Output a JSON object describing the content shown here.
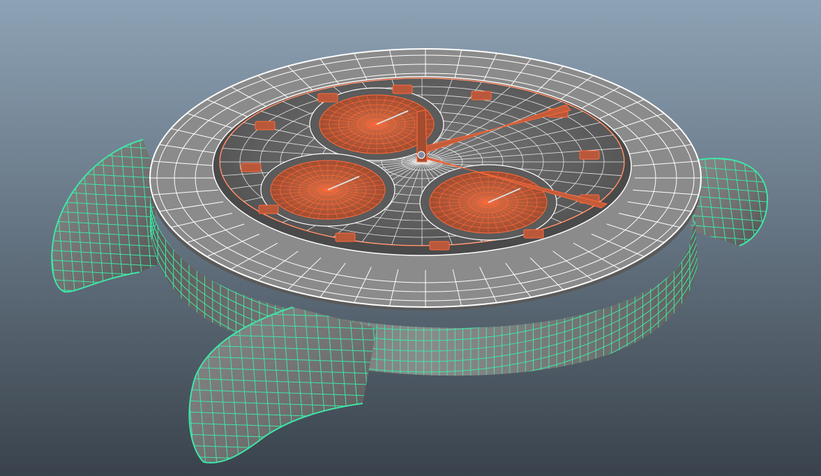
{
  "viewport": {
    "background_top": "#8da2b5",
    "background_bottom": "#3a434c"
  },
  "model": {
    "shaded_surface": "#848484",
    "case_wire": "#3fe6a8",
    "bezel_wire": "#ffffff",
    "dial_wire": "#ff6a3a",
    "dial_component_fill": "#b9583a",
    "hands": [
      "hour-hand",
      "minute-hand",
      "chronograph-second-hand"
    ],
    "subdials": [
      "top-subdial",
      "left-subdial",
      "right-subdial"
    ]
  }
}
